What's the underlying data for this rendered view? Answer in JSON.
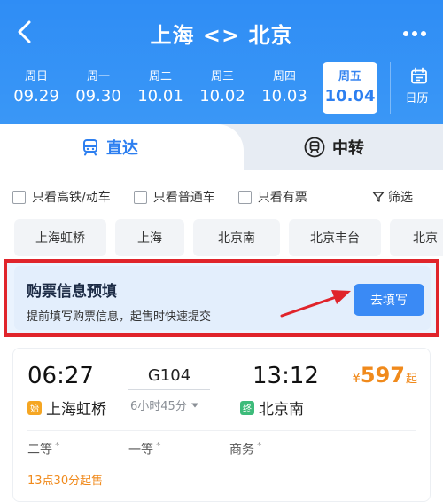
{
  "header": {
    "title": "上海 <> 北京",
    "back_icon": "back-chevron-icon",
    "more_icon": "more-dots-icon",
    "bg_color": "#2f8df5"
  },
  "dates": [
    {
      "weekday": "周日",
      "date": "09.29",
      "selected": false
    },
    {
      "weekday": "周一",
      "date": "09.30",
      "selected": false
    },
    {
      "weekday": "周二",
      "date": "10.01",
      "selected": false
    },
    {
      "weekday": "周三",
      "date": "10.02",
      "selected": false
    },
    {
      "weekday": "周四",
      "date": "10.03",
      "selected": false
    },
    {
      "weekday": "周五",
      "date": "10.04",
      "selected": true
    }
  ],
  "calendar": {
    "label": "日历",
    "icon": "calendar-icon"
  },
  "tabs": {
    "direct": {
      "label": "直达",
      "icon": "train-icon",
      "active": true
    },
    "transfer": {
      "label": "中转",
      "icon": "transfer-train-icon",
      "active": false
    }
  },
  "filters": {
    "high_speed": "只看高铁/动车",
    "normal": "只看普通车",
    "has_ticket": "只看有票",
    "filter_label": "筛选"
  },
  "stations": [
    "上海虹桥",
    "上海",
    "北京南",
    "北京丰台",
    "北京"
  ],
  "promo": {
    "title": "购票信息预填",
    "desc": "提前填写购票信息，起售时快速提交",
    "button": "去填写",
    "highlight_color": "#e0242b"
  },
  "train": {
    "dep_time": "06:27",
    "arr_time": "13:12",
    "number": "G104",
    "duration": "6小时45分",
    "dep_station": "上海虹桥",
    "arr_station": "北京南",
    "start_badge": "始",
    "end_badge": "终",
    "price_currency": "¥",
    "price": "597",
    "price_suffix": "起",
    "seats": [
      {
        "name": "二等",
        "mark": "*"
      },
      {
        "name": "一等",
        "mark": "*"
      },
      {
        "name": "商务",
        "mark": "*"
      }
    ],
    "sale_note": "13点30分起售",
    "accent_color": "#f08a1c"
  }
}
